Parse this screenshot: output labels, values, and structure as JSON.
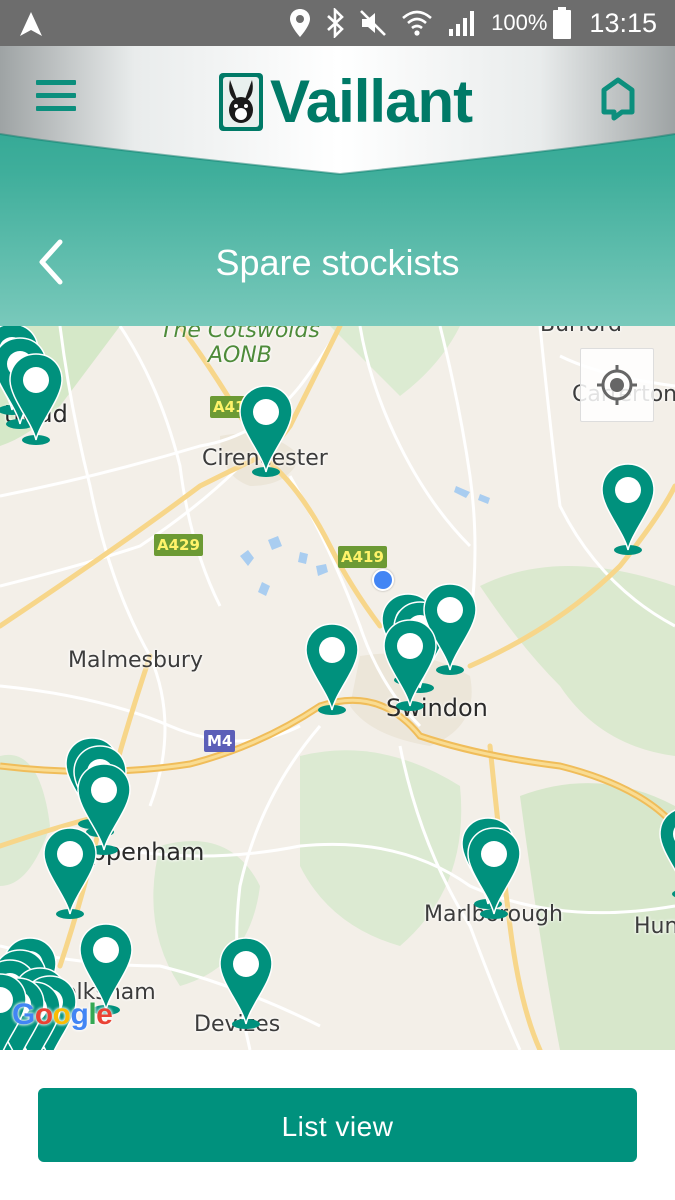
{
  "status_bar": {
    "battery_percent": "100%",
    "time": "13:15",
    "icons": [
      "navigation-icon",
      "location-icon",
      "bluetooth-icon",
      "mute-icon",
      "wifi-icon",
      "signal-icon",
      "battery-icon"
    ]
  },
  "header": {
    "brand": "Vaillant",
    "title": "Spare stockists",
    "menu_icon": "hamburger-menu-icon",
    "home_icon": "home-icon",
    "back_icon": "chevron-left-icon",
    "colors": {
      "teal": "#00917d",
      "logo_green": "#007a67"
    }
  },
  "map": {
    "aonb_label_line1": "The Cotswolds",
    "aonb_label_line2": "AONB",
    "places": {
      "burford": "Burford",
      "carterton": "Carterton",
      "stroud": "troud",
      "cirencester": "Cirencester",
      "malmesbury": "Malmesbury",
      "swindon": "Swindon",
      "chippenham": "Chippenham",
      "marlborough": "Marlborough",
      "hungerford": "Hung",
      "melksham": "Melksham",
      "devizes": "Devizes"
    },
    "roads": {
      "a419_north": "A41",
      "a429": "A429",
      "a419": "A419",
      "m4": "M4"
    },
    "attribution": "Google",
    "pin_color": "#00917d",
    "stockist_pin_count": 27
  },
  "footer": {
    "list_view_label": "List view"
  }
}
